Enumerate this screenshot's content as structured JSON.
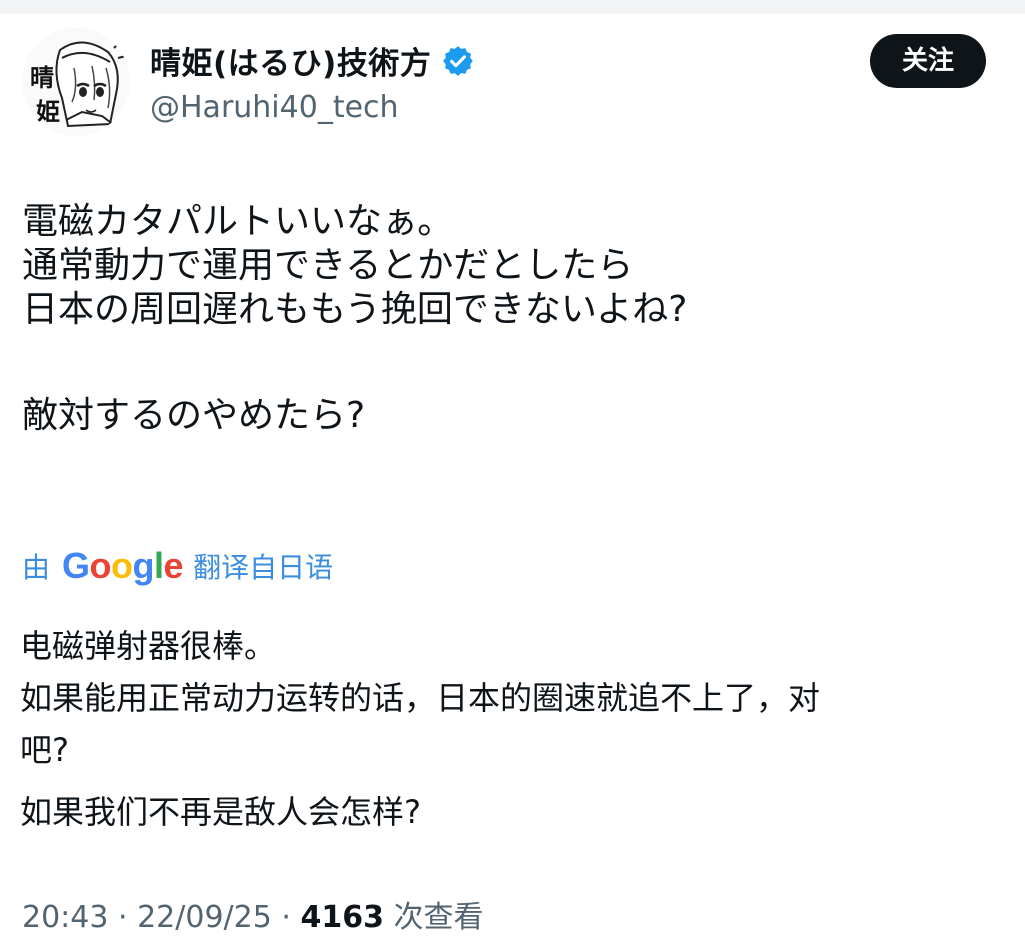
{
  "tweet": {
    "author": {
      "display_name": "晴姫(はるひ)技術方",
      "handle": "@Haruhi40_tech",
      "avatar_text": [
        "晴",
        "姫"
      ],
      "verified": true
    },
    "follow_label": "关注",
    "text_lines": [
      "電磁カタパルトいいなぁ。",
      "通常動力で運用できるとかだとしたら",
      "日本の周回遅れももう挽回できないよね?",
      "",
      "敵対するのやめたら?"
    ],
    "translate": {
      "prefix": "由",
      "provider": "Google",
      "suffix": "翻译自日语"
    },
    "translation_lines": [
      "电磁弹射器很棒。",
      "如果能用正常动力运转的话，日本的圈速就追不上了，对",
      "吧?",
      "",
      "如果我们不再是敌人会怎样?"
    ],
    "meta": {
      "time": "20:43",
      "date": "22/09/25",
      "views": "4163",
      "views_suffix": "次查看"
    }
  },
  "colors": {
    "text": "#0f1419",
    "secondary": "#536471",
    "link_blue": "#3b8de0",
    "verified_blue": "#1d9bf0",
    "google": [
      "#4285f4",
      "#ea4335",
      "#fbbc05",
      "#4285f4",
      "#34a853",
      "#ea4335"
    ]
  },
  "icons": [
    "verified-badge-icon",
    "avatar-image"
  ]
}
